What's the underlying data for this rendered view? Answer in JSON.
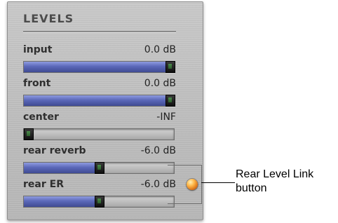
{
  "panel": {
    "title": "LEVELS",
    "rows": [
      {
        "label": "input",
        "value": "0.0 dB",
        "level": 1.0
      },
      {
        "label": "front",
        "value": "0.0 dB",
        "level": 1.0
      },
      {
        "label": "center",
        "value": "-INF",
        "level": 0.0
      },
      {
        "label": "rear reverb",
        "value": "-6.0 dB",
        "level": 0.5
      },
      {
        "label": "rear ER",
        "value": "-6.0 dB",
        "level": 0.5
      }
    ]
  },
  "callout": {
    "text_line1": "Rear Level Link",
    "text_line2": "button"
  }
}
